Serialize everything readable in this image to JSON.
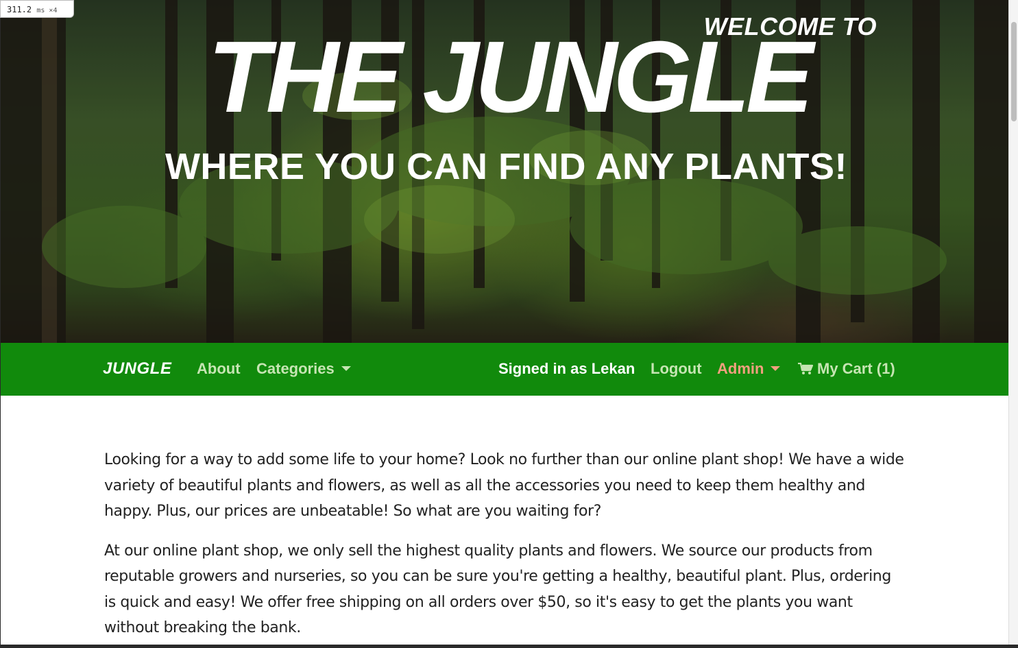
{
  "perf_timer": {
    "value": "311.2",
    "unit": "ms ×4"
  },
  "hero": {
    "welcome": "WELCOME TO",
    "title": "THE JUNGLE",
    "subtitle": "WHERE YOU CAN FIND ANY PLANTS!"
  },
  "navbar": {
    "brand": "JUNGLE",
    "about": "About",
    "categories": "Categories",
    "signed_in": "Signed in as Lekan",
    "logout": "Logout",
    "admin": "Admin",
    "cart": "My Cart (1)",
    "cart_icon": "shopping-cart-icon",
    "colors": {
      "background": "#118a0c",
      "link": "#c6e5b3",
      "admin": "#f2a07f"
    }
  },
  "content": {
    "paragraphs": [
      "Looking for a way to add some life to your home? Look no further than our online plant shop! We have a wide variety of beautiful plants and flowers, as well as all the accessories you need to keep them healthy and happy. Plus, our prices are unbeatable! So what are you waiting for?",
      "At our online plant shop, we only sell the highest quality plants and flowers. We source our products from reputable growers and nurseries, so you can be sure you're getting a healthy, beautiful plant. Plus, ordering is quick and easy! We offer free shipping on all orders over $50, so it's easy to get the plants you want without breaking the bank."
    ]
  }
}
